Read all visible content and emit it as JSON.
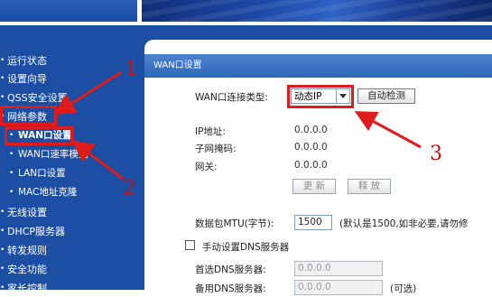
{
  "sidebar": {
    "items": [
      {
        "label": "运行状态",
        "level": "top"
      },
      {
        "label": "设置向导",
        "level": "top"
      },
      {
        "label": "QSS安全设置",
        "level": "top"
      },
      {
        "label": "网络参数",
        "level": "top",
        "highlighted": true
      },
      {
        "label": "WAN口设置",
        "level": "sub",
        "active": true
      },
      {
        "label": "WAN口速率模式",
        "level": "sub"
      },
      {
        "label": "LAN口设置",
        "level": "sub"
      },
      {
        "label": "MAC地址克隆",
        "level": "sub"
      },
      {
        "label": "无线设置",
        "level": "top"
      },
      {
        "label": "DHCP服务器",
        "level": "top"
      },
      {
        "label": "转发规则",
        "level": "top"
      },
      {
        "label": "安全功能",
        "level": "top"
      },
      {
        "label": "家长控制",
        "level": "top"
      }
    ]
  },
  "panel": {
    "title": "WAN口设置",
    "connection_type_label": "WAN口连接类型:",
    "connection_type_value": "动态IP",
    "auto_detect_button": "自动检测",
    "ip_label": "IP地址:",
    "ip_value": "0.0.0.0",
    "mask_label": "子网掩码:",
    "mask_value": "0.0.0.0",
    "gateway_label": "网关:",
    "gateway_value": "0.0.0.0",
    "renew_button": "更 新",
    "release_button": "释 放",
    "mtu_label": "数据包MTU(字节):",
    "mtu_value": "1500",
    "mtu_hint": "(默认是1500,如非必要,请勿修",
    "manual_dns_label": "手动设置DNS服务器",
    "manual_dns_checked": false,
    "primary_dns_label": "首选DNS服务器:",
    "primary_dns_value": "0.0.0.0",
    "secondary_dns_label": "备用DNS服务器:",
    "secondary_dns_value": "0.0.0.0",
    "secondary_dns_hint": "(可选)"
  },
  "annotations": {
    "step1": "1",
    "step2": "2",
    "step3": "3",
    "color": "#e01b1b"
  },
  "colors": {
    "sidebar_bg": "#1c4fa3",
    "title_bar": "#3d74c4"
  }
}
